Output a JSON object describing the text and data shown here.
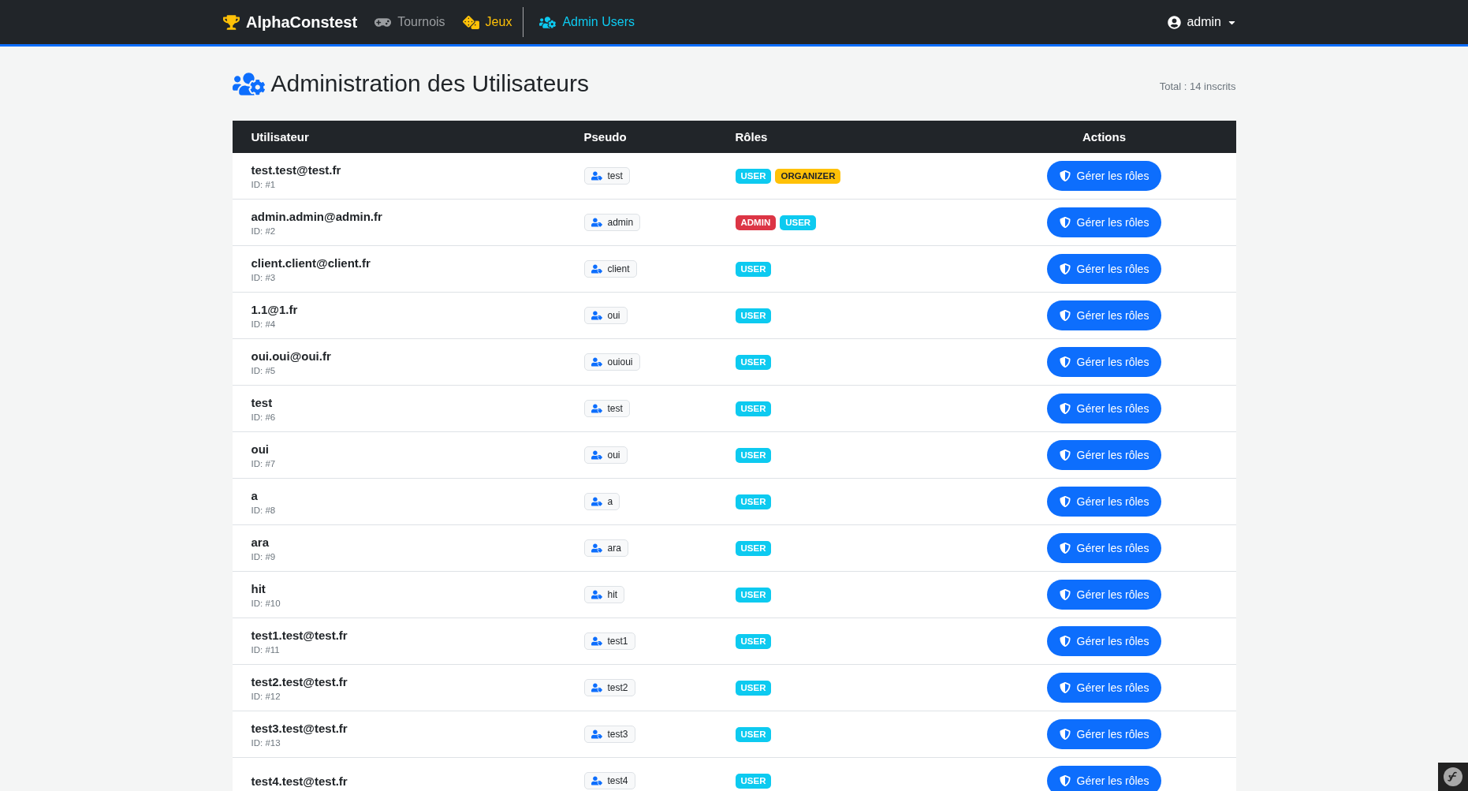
{
  "navbar": {
    "brand": "AlphaConstest",
    "links": [
      {
        "label": "Tournois",
        "color": "#9a9da0"
      },
      {
        "label": "Jeux",
        "color": "#ffc107"
      },
      {
        "label": "Admin Users",
        "color": "#0dcaf0"
      }
    ],
    "user_menu": {
      "label": "admin"
    }
  },
  "page": {
    "title": "Administration des Utilisateurs",
    "total": "Total : 14 inscrits"
  },
  "table": {
    "columns": [
      "Utilisateur",
      "Pseudo",
      "Rôles",
      "Actions"
    ],
    "rows": [
      {
        "email": "test.test@test.fr",
        "id": "ID: #1",
        "pseudo": "test",
        "roles": [
          {
            "label": "USER",
            "color": "#0dcaf0"
          },
          {
            "label": "ORGANIZER",
            "color": "#ffc107"
          }
        ],
        "action": "Gérer les rôles"
      },
      {
        "email": "admin.admin@admin.fr",
        "id": "ID: #2",
        "pseudo": "admin",
        "roles": [
          {
            "label": "ADMIN",
            "color": "#dc3545"
          },
          {
            "label": "USER",
            "color": "#0dcaf0"
          }
        ],
        "action": "Gérer les rôles"
      },
      {
        "email": "client.client@client.fr",
        "id": "ID: #3",
        "pseudo": "client",
        "roles": [
          {
            "label": "USER",
            "color": "#0dcaf0"
          }
        ],
        "action": "Gérer les rôles"
      },
      {
        "email": "1.1@1.fr",
        "id": "ID: #4",
        "pseudo": "oui",
        "roles": [
          {
            "label": "USER",
            "color": "#0dcaf0"
          }
        ],
        "action": "Gérer les rôles"
      },
      {
        "email": "oui.oui@oui.fr",
        "id": "ID: #5",
        "pseudo": "ouioui",
        "roles": [
          {
            "label": "USER",
            "color": "#0dcaf0"
          }
        ],
        "action": "Gérer les rôles"
      },
      {
        "email": "test",
        "id": "ID: #6",
        "pseudo": "test",
        "roles": [
          {
            "label": "USER",
            "color": "#0dcaf0"
          }
        ],
        "action": "Gérer les rôles"
      },
      {
        "email": "oui",
        "id": "ID: #7",
        "pseudo": "oui",
        "roles": [
          {
            "label": "USER",
            "color": "#0dcaf0"
          }
        ],
        "action": "Gérer les rôles"
      },
      {
        "email": "a",
        "id": "ID: #8",
        "pseudo": "a",
        "roles": [
          {
            "label": "USER",
            "color": "#0dcaf0"
          }
        ],
        "action": "Gérer les rôles"
      },
      {
        "email": "ara",
        "id": "ID: #9",
        "pseudo": "ara",
        "roles": [
          {
            "label": "USER",
            "color": "#0dcaf0"
          }
        ],
        "action": "Gérer les rôles"
      },
      {
        "email": "hit",
        "id": "ID: #10",
        "pseudo": "hit",
        "roles": [
          {
            "label": "USER",
            "color": "#0dcaf0"
          }
        ],
        "action": "Gérer les rôles"
      },
      {
        "email": "test1.test@test.fr",
        "id": "ID: #11",
        "pseudo": "test1",
        "roles": [
          {
            "label": "USER",
            "color": "#0dcaf0"
          }
        ],
        "action": "Gérer les rôles"
      },
      {
        "email": "test2.test@test.fr",
        "id": "ID: #12",
        "pseudo": "test2",
        "roles": [
          {
            "label": "USER",
            "color": "#0dcaf0"
          }
        ],
        "action": "Gérer les rôles"
      },
      {
        "email": "test3.test@test.fr",
        "id": "ID: #13",
        "pseudo": "test3",
        "roles": [
          {
            "label": "USER",
            "color": "#0dcaf0"
          }
        ],
        "action": "Gérer les rôles"
      },
      {
        "email": "test4.test@test.fr",
        "pseudo": "test4",
        "roles": [
          {
            "label": "USER",
            "color": "#0dcaf0"
          }
        ],
        "action": "Gérer les rôles"
      }
    ]
  }
}
